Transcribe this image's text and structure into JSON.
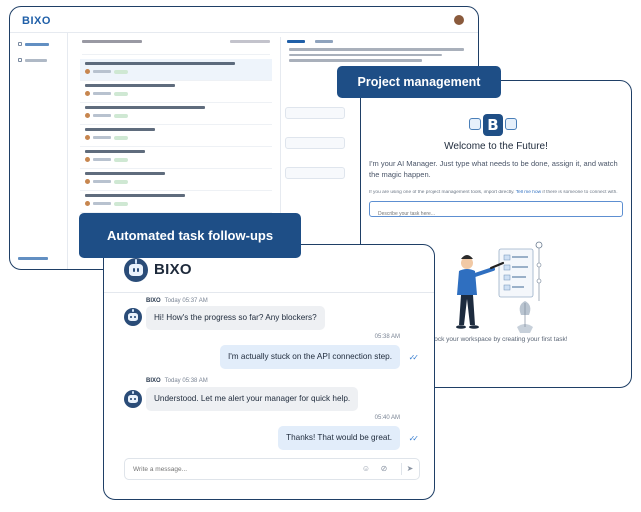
{
  "dashboard": {
    "logo": "BIXO"
  },
  "project": {
    "label": "Project management",
    "logo_letter": "B",
    "welcome": "Welcome to the Future!",
    "intro": "I'm your AI Manager. Just type what needs to be done, assign it, and watch the magic happen.",
    "hint_prefix": "If you are using one of the project management tools, import directly.",
    "hint_link": "Tell me how",
    "hint_suffix": "if there is someone to connect with.",
    "input_placeholder": "Describe your task here...",
    "tagline": "Unlock your workspace by creating your first task!"
  },
  "automated": {
    "label": "Automated task follow-ups"
  },
  "chat": {
    "title": "BIXO",
    "messages": [
      {
        "sender": "BIXO",
        "day": "Today",
        "time": "05:37 AM",
        "text": "Hi! How's the progress so far? Any blockers?",
        "direction": "in"
      },
      {
        "time": "05:38 AM",
        "text": "I'm actually stuck on the API connection step.",
        "direction": "out"
      },
      {
        "sender": "BIXO",
        "day": "Today",
        "time": "05:38 AM",
        "text": "Understood. Let me alert your manager for quick help.",
        "direction": "in"
      },
      {
        "time": "05:40 AM",
        "text": "Thanks! That would be great.",
        "direction": "out"
      }
    ],
    "input_placeholder": "Write a message...",
    "icons": [
      "emoji-icon",
      "attach-icon",
      "send-icon"
    ]
  },
  "colors": {
    "brand": "#1e4e86",
    "accent": "#3a7fd0",
    "card_border": "#1f3f66"
  }
}
